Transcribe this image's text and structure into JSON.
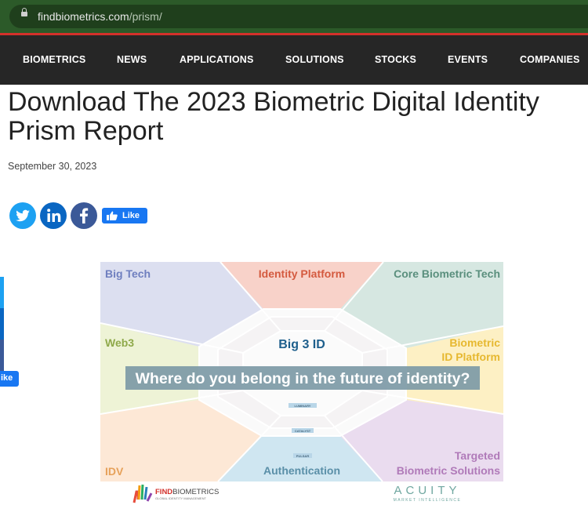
{
  "browser": {
    "url_domain": "findbiometrics.com",
    "url_path": "/prism/"
  },
  "nav": {
    "items": [
      "BIOMETRICS",
      "NEWS",
      "APPLICATIONS",
      "SOLUTIONS",
      "STOCKS",
      "EVENTS",
      "COMPANIES"
    ]
  },
  "article": {
    "title": "Download The 2023 Biometric Digital Identity Prism Report",
    "date": "September 30, 2023"
  },
  "social": {
    "icons": [
      "twitter-icon",
      "linkedin-icon",
      "facebook-icon"
    ],
    "like_label": "Like",
    "side_like_label": "ike"
  },
  "prism": {
    "big_tech": "Big Tech",
    "identity_platform": "Identity Platform",
    "core_biometric_tech": "Core Biometric Tech",
    "web3": "Web3",
    "big3_id": "Big 3 ID",
    "biometric_id_platform_1": "Biometric",
    "biometric_id_platform_2": "ID Platform",
    "banner": "Where do you belong in the future of identity?",
    "luminary": "LUMINARY",
    "catalyst": "CATALYST",
    "pulsar": "PULSAR",
    "idv": "IDV",
    "authentication": "Authentication",
    "targeted_1": "Targeted",
    "targeted_2": "Biometric Solutions"
  },
  "logos": {
    "find_1": "FIND",
    "find_2": "BIOMETRICS",
    "find_sub": "GLOBAL IDENTITY MANAGEMENT",
    "acuity": "ACUITY",
    "acuity_sub": "MARKET INTELLIGENCE"
  },
  "colors": {
    "nav_bg": "#262626",
    "accent_red": "#d3312b",
    "twitter": "#1da1f2",
    "linkedin": "#0a66c2",
    "facebook": "#3b5998",
    "fb_like": "#1877f2"
  }
}
